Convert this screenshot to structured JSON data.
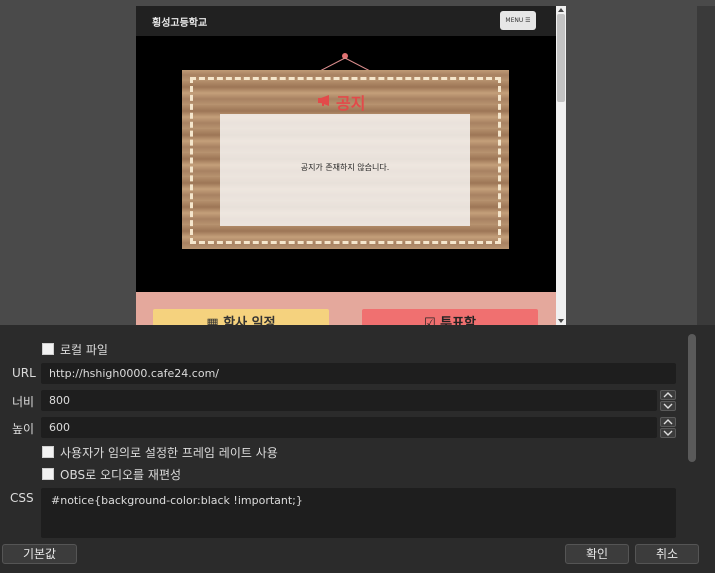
{
  "preview": {
    "site_title": "횡성고등학교",
    "menu_label": "MENU ☰",
    "notice_title": "공지",
    "notice_message": "공지가 존재하지 않습니다.",
    "schedule_button": "학사 일정",
    "vote_button": "투표함",
    "colors": {
      "board_accent": "#e24a4a",
      "schedule_bg": "#f5d27e",
      "vote_bg": "#f07070",
      "section_bg": "#e4a89c"
    }
  },
  "properties": {
    "local_file_label": "로컬 파일",
    "url_label": "URL",
    "url_value": "http://hshigh0000.cafe24.com/",
    "width_label": "너비",
    "width_value": "800",
    "height_label": "높이",
    "height_value": "600",
    "custom_fps_label": "사용자가 임의로 설정한 프레임 레이트 사용",
    "reroute_audio_label": "OBS로 오디오를 재편성",
    "css_label": "CSS",
    "css_value": "#notice{background-color:black !important;}"
  },
  "footer": {
    "defaults_button": "기본값",
    "ok_button": "확인",
    "cancel_button": "취소"
  }
}
